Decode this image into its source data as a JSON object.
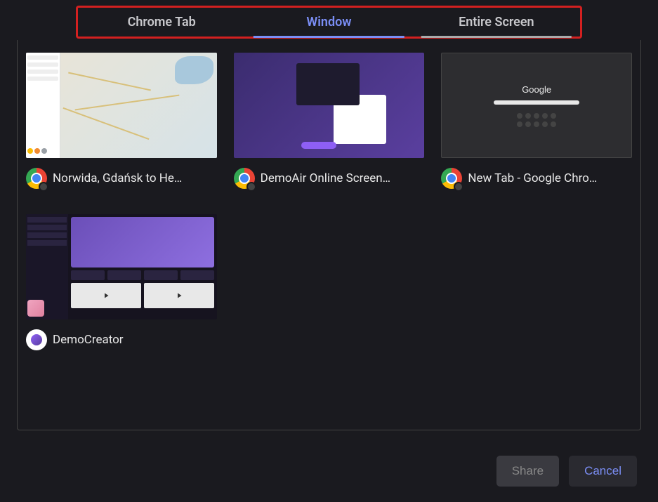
{
  "tabs": {
    "chrome_tab": "Chrome Tab",
    "window": "Window",
    "entire_screen": "Entire Screen",
    "active": "window"
  },
  "windows": [
    {
      "label": "Norwida, Gdańsk to He…",
      "icon": "chrome"
    },
    {
      "label": "DemoAir Online Screen…",
      "icon": "chrome"
    },
    {
      "label": "New Tab - Google Chro…",
      "icon": "chrome"
    },
    {
      "label": "DemoCreator",
      "icon": "democreator"
    }
  ],
  "footer": {
    "share_label": "Share",
    "cancel_label": "Cancel"
  },
  "thumb_google_logo": "Google"
}
